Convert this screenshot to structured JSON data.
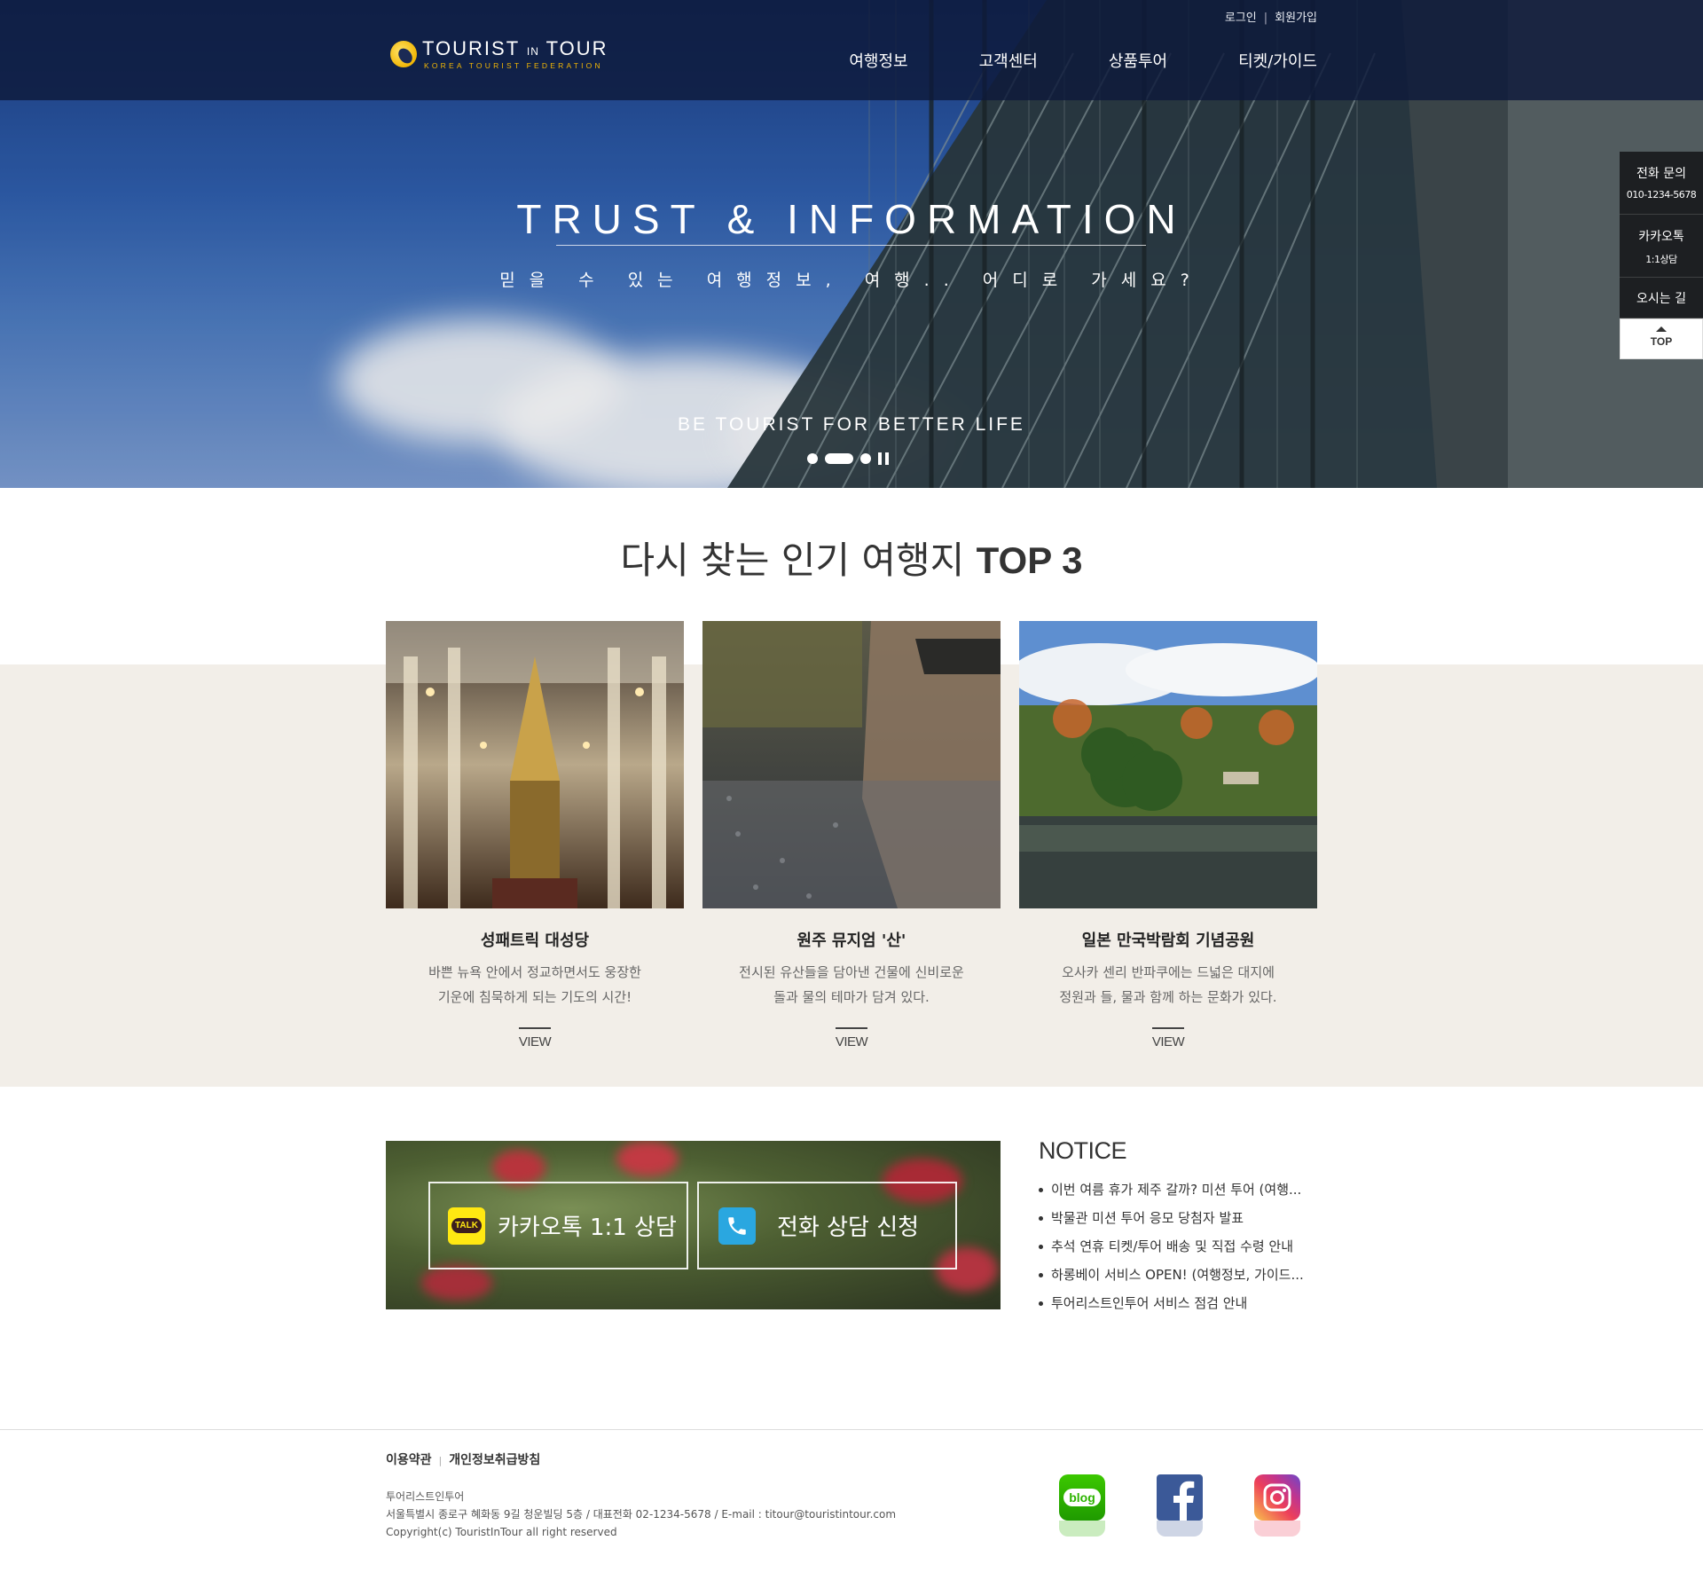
{
  "header": {
    "logo_name": "TOURIST",
    "logo_in": "IN",
    "logo_tour": "TOUR",
    "logo_sub": "KOREA TOURIST FEDERATION",
    "util": {
      "login": "로그인",
      "join": "회원가입",
      "sep": "|"
    },
    "nav": [
      "여행정보",
      "고객센터",
      "상품투어",
      "티켓/가이드"
    ]
  },
  "hero": {
    "title": "TRUST & INFORMATION",
    "subtitle": "믿을 수 있는 여행정보, 여행.. 어디로 가세요?",
    "bottom": "BE TOURIST FOR BETTER LIFE",
    "slide_count": 3,
    "active_slide": 2
  },
  "quick_menu": {
    "phone_title": "전화 문의",
    "phone_number": "010-1234-5678",
    "kakao_title": "카카오톡",
    "kakao_sub": "1:1상담",
    "directions": "오시는 길",
    "top": "TOP"
  },
  "top3": {
    "title_prefix": "다시 찾는 인기 여행지",
    "title_bold": "TOP 3",
    "cards": [
      {
        "title": "성패트릭 대성당",
        "desc1": "바쁜 뉴욕 안에서 정교하면서도 웅장한",
        "desc2": "기운에 침묵하게 되는 기도의 시간!",
        "view": "VIEW"
      },
      {
        "title": "원주 뮤지엄 '산'",
        "desc1": "전시된 유산들을 담아낸 건물에 신비로운",
        "desc2": "돌과 물의 테마가 담겨 있다.",
        "view": "VIEW"
      },
      {
        "title": "일본 만국박람회 기념공원",
        "desc1": "오사카 센리 반파쿠에는 드넓은 대지에",
        "desc2": "정원과 들, 물과 함께 하는 문화가 있다.",
        "view": "VIEW"
      }
    ]
  },
  "banner": {
    "kakao_label": "카카오톡 1:1 상담",
    "kakao_icon_text": "TALK",
    "phone_label": "전화 상담 신청"
  },
  "notice": {
    "title": "NOTICE",
    "items": [
      "이번 여름 휴가 제주 갈까? 미션 투어 (여행...",
      "박물관 미션 투어 응모 당첨자 발표",
      "추석 연휴 티켓/투어 배송 및 직접 수령 안내",
      "하롱베이 서비스 OPEN! (여행정보, 가이드...",
      "투어리스트인투어 서비스 점검 안내"
    ]
  },
  "footer": {
    "terms": "이용약관",
    "privacy": "개인정보취급방침",
    "sep": "|",
    "company": "투어리스트인투어",
    "address": "서울특별시 종로구 혜화동 9길 청운빌딩 5층 / 대표전화 02-1234-5678 / E-mail : titour@touristintour.com",
    "copyright": "Copyright(c) TouristInTour all right reserved",
    "sns": {
      "blog": "blog"
    }
  },
  "colors": {
    "header_bg": "#0e1a3a",
    "accent_yellow": "#f2b705",
    "beige_bg": "#f2eee8",
    "kakao_yellow": "#ffe812",
    "phone_blue": "#2aa7e0",
    "blog_green": "#2db400",
    "facebook_blue": "#3b5998"
  }
}
